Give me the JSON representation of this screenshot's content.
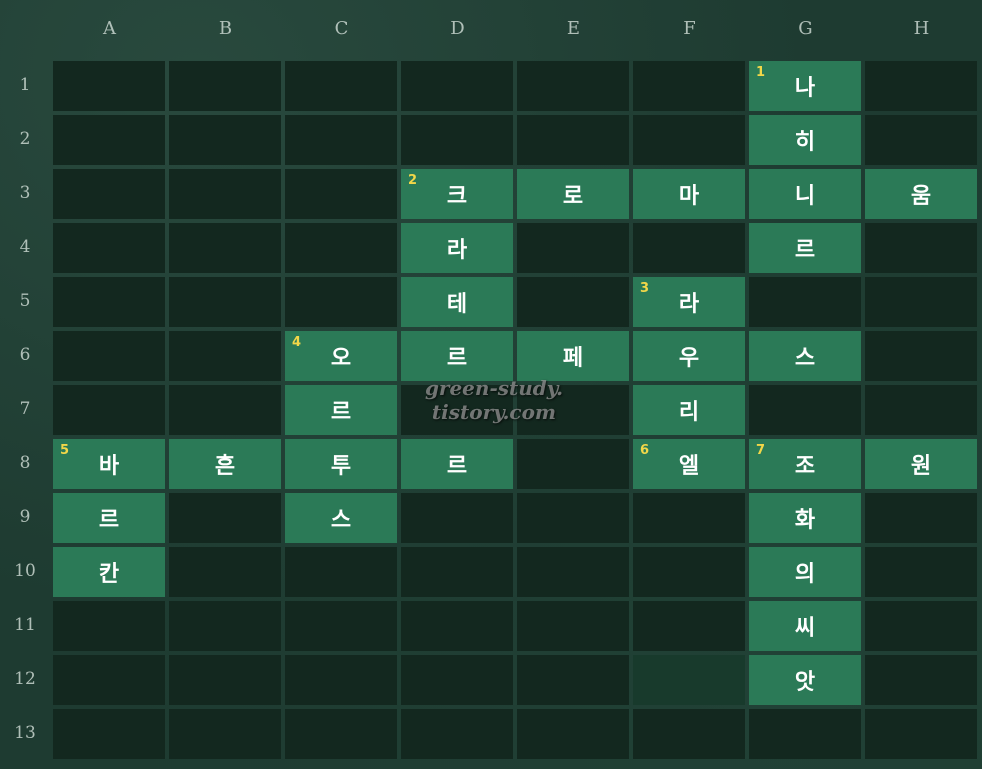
{
  "columns": [
    "A",
    "B",
    "C",
    "D",
    "E",
    "F",
    "G",
    "H"
  ],
  "rows": [
    "1",
    "2",
    "3",
    "4",
    "5",
    "6",
    "7",
    "8",
    "9",
    "10",
    "11",
    "12",
    "13"
  ],
  "cells": [
    {
      "col": 6,
      "row": 0,
      "num": "1",
      "char": "나"
    },
    {
      "col": 6,
      "row": 1,
      "num": "",
      "char": "히"
    },
    {
      "col": 3,
      "row": 2,
      "num": "2",
      "char": "크"
    },
    {
      "col": 4,
      "row": 2,
      "num": "",
      "char": "로"
    },
    {
      "col": 5,
      "row": 2,
      "num": "",
      "char": "마"
    },
    {
      "col": 6,
      "row": 2,
      "num": "",
      "char": "니"
    },
    {
      "col": 7,
      "row": 2,
      "num": "",
      "char": "움"
    },
    {
      "col": 3,
      "row": 3,
      "num": "",
      "char": "라"
    },
    {
      "col": 6,
      "row": 3,
      "num": "",
      "char": "르"
    },
    {
      "col": 3,
      "row": 4,
      "num": "",
      "char": "테"
    },
    {
      "col": 5,
      "row": 4,
      "num": "3",
      "char": "라"
    },
    {
      "col": 2,
      "row": 5,
      "num": "4",
      "char": "오"
    },
    {
      "col": 3,
      "row": 5,
      "num": "",
      "char": "르"
    },
    {
      "col": 4,
      "row": 5,
      "num": "",
      "char": "페"
    },
    {
      "col": 5,
      "row": 5,
      "num": "",
      "char": "우"
    },
    {
      "col": 6,
      "row": 5,
      "num": "",
      "char": "스"
    },
    {
      "col": 2,
      "row": 6,
      "num": "",
      "char": "르"
    },
    {
      "col": 5,
      "row": 6,
      "num": "",
      "char": "리"
    },
    {
      "col": 0,
      "row": 7,
      "num": "5",
      "char": "바"
    },
    {
      "col": 1,
      "row": 7,
      "num": "",
      "char": "흔"
    },
    {
      "col": 2,
      "row": 7,
      "num": "",
      "char": "투"
    },
    {
      "col": 3,
      "row": 7,
      "num": "",
      "char": "르"
    },
    {
      "col": 5,
      "row": 7,
      "num": "6",
      "char": "엘"
    },
    {
      "col": 6,
      "row": 7,
      "num": "7",
      "char": "조"
    },
    {
      "col": 7,
      "row": 7,
      "num": "",
      "char": "원"
    },
    {
      "col": 0,
      "row": 8,
      "num": "",
      "char": "르"
    },
    {
      "col": 2,
      "row": 8,
      "num": "",
      "char": "스"
    },
    {
      "col": 6,
      "row": 8,
      "num": "",
      "char": "화"
    },
    {
      "col": 0,
      "row": 9,
      "num": "",
      "char": "칸"
    },
    {
      "col": 6,
      "row": 9,
      "num": "",
      "char": "의"
    },
    {
      "col": 6,
      "row": 10,
      "num": "",
      "char": "씨"
    },
    {
      "col": 6,
      "row": 11,
      "num": "",
      "char": "앗"
    }
  ],
  "highlighted_empty_cells": [
    {
      "col": 5,
      "row": 11
    }
  ],
  "watermark": {
    "line1": "green-study.",
    "line2": "tistory.com"
  },
  "colors": {
    "board": "#1e3b31",
    "empty_cell": "#13281f",
    "filled_cell": "#2b7a57",
    "clue_number": "#f2d749",
    "letter": "#ffffff"
  }
}
